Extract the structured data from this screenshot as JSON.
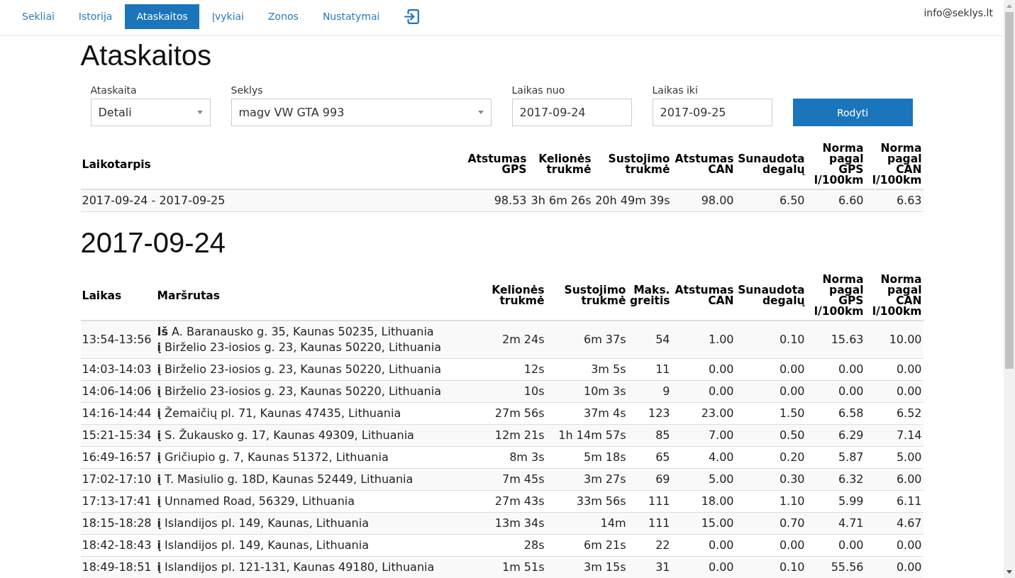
{
  "nav": {
    "tabs": [
      {
        "label": "Sekliai",
        "selected": false
      },
      {
        "label": "Istorija",
        "selected": false
      },
      {
        "label": "Ataskaitos",
        "selected": true
      },
      {
        "label": "Įvykiai",
        "selected": false
      },
      {
        "label": "Zonos",
        "selected": false
      },
      {
        "label": "Nustatymai",
        "selected": false
      }
    ],
    "user_email": "info@seklys.lt"
  },
  "page_title": "Ataskaitos",
  "filters": {
    "fields": [
      {
        "kind": "select",
        "label": "Ataskaita",
        "value": "Detali"
      },
      {
        "kind": "select",
        "label": "Seklys",
        "value": "magv VW GTA 993"
      },
      {
        "kind": "date",
        "label": "Laikas nuo",
        "value": "2017-09-24"
      },
      {
        "kind": "date",
        "label": "Laikas iki",
        "value": "2017-09-25"
      }
    ],
    "submit_button": "Rodyti"
  },
  "summary_table": {
    "columns": [
      "Laikotarpis",
      "Atstumas GPS",
      "Kelionės trukmė",
      "Sustojimo trukmė",
      "Atstumas CAN",
      "Sunaudota degalų",
      "Norma pagal GPS l/100km",
      "Norma pagal CAN l/100km"
    ],
    "rows": [
      [
        "2017-09-24 - 2017-09-25",
        "98.53",
        "3h 6m 26s",
        "20h 49m 39s",
        "98.00",
        "6.50",
        "6.60",
        "6.63"
      ]
    ]
  },
  "day_sections": [
    {
      "date": "2017-09-24",
      "table": {
        "columns": [
          "Laikas",
          "Maršrutas",
          "Kelionės trukmė",
          "Sustojimo trukmė",
          "Maks. greitis",
          "Atstumas CAN",
          "Sunaudota degalų",
          "Norma pagal GPS l/100km",
          "Norma pagal CAN l/100km"
        ],
        "rows": [
          {
            "time": "13:54-13:56",
            "route": [
              "**Iš** A. Baranausko g. 35, Kaunas 50235, Lithuania",
              "**į** Birželio 23-iosios g. 23, Kaunas 50220, Lithuania"
            ],
            "values": [
              "2m 24s",
              "6m 37s",
              "54",
              "1.00",
              "0.10",
              "15.63",
              "10.00"
            ]
          },
          {
            "time": "14:03-14:03",
            "route": [
              "**į** Birželio 23-iosios g. 23, Kaunas 50220, Lithuania"
            ],
            "values": [
              "12s",
              "3m 5s",
              "11",
              "0.00",
              "0.00",
              "0.00",
              "0.00"
            ]
          },
          {
            "time": "14:06-14:06",
            "route": [
              "**į** Birželio 23-iosios g. 23, Kaunas 50220, Lithuania"
            ],
            "values": [
              "10s",
              "10m 3s",
              "9",
              "0.00",
              "0.00",
              "0.00",
              "0.00"
            ]
          },
          {
            "time": "14:16-14:44",
            "route": [
              "**į** Žemaičių pl. 71, Kaunas 47435, Lithuania"
            ],
            "values": [
              "27m 56s",
              "37m 4s",
              "123",
              "23.00",
              "1.50",
              "6.58",
              "6.52"
            ]
          },
          {
            "time": "15:21-15:34",
            "route": [
              "**į** S. Žukausko g. 17, Kaunas 49309, Lithuania"
            ],
            "values": [
              "12m 21s",
              "1h 14m 57s",
              "85",
              "7.00",
              "0.50",
              "6.29",
              "7.14"
            ]
          },
          {
            "time": "16:49-16:57",
            "route": [
              "**į** Gričiupio g. 7, Kaunas 51372, Lithuania"
            ],
            "values": [
              "8m 3s",
              "5m 18s",
              "65",
              "4.00",
              "0.20",
              "5.87",
              "5.00"
            ]
          },
          {
            "time": "17:02-17:10",
            "route": [
              "**į** T. Masiulio g. 18D, Kaunas 52449, Lithuania"
            ],
            "values": [
              "7m 45s",
              "3m 27s",
              "69",
              "5.00",
              "0.30",
              "6.32",
              "6.00"
            ]
          },
          {
            "time": "17:13-17:41",
            "route": [
              "**į** Unnamed Road, 56329, Lithuania"
            ],
            "values": [
              "27m 43s",
              "33m 56s",
              "111",
              "18.00",
              "1.10",
              "5.99",
              "6.11"
            ]
          },
          {
            "time": "18:15-18:28",
            "route": [
              "**į** Islandijos pl. 149, Kaunas, Lithuania"
            ],
            "values": [
              "13m 34s",
              "14m",
              "111",
              "15.00",
              "0.70",
              "4.71",
              "4.67"
            ]
          },
          {
            "time": "18:42-18:43",
            "route": [
              "**į** Islandijos pl. 149, Kaunas, Lithuania"
            ],
            "values": [
              "28s",
              "6m 21s",
              "22",
              "0.00",
              "0.00",
              "0.00",
              "0.00"
            ]
          },
          {
            "time": "18:49-18:51",
            "route": [
              "**į** Islandijos pl. 121-131, Kaunas 49180, Lithuania"
            ],
            "values": [
              "1m 51s",
              "3m 15s",
              "31",
              "0.00",
              "0.10",
              "55.56",
              "0.00"
            ]
          }
        ]
      }
    }
  ]
}
